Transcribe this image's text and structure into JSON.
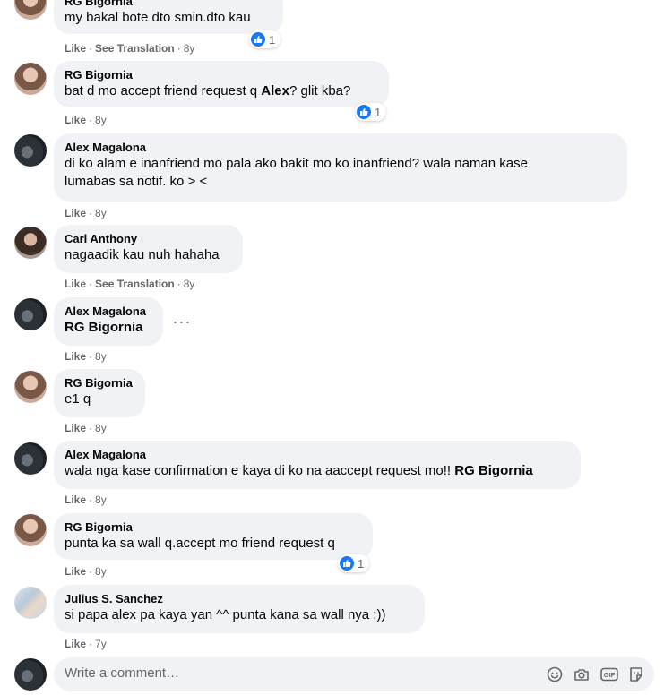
{
  "comments": [
    {
      "author": "RG Bigornia",
      "text": "my bakal bote dto smin.dto kau",
      "actions": [
        "Like",
        "See Translation"
      ],
      "time": "8y",
      "reactions": "1"
    },
    {
      "author": "RG Bigornia",
      "text_before": "bat d mo accept friend request q ",
      "mention": "Alex",
      "text_after": "? glit kba?",
      "actions": [
        "Like"
      ],
      "time": "8y",
      "reactions": "1"
    },
    {
      "author": "Alex Magalona",
      "text_line1": "di ko alam e inanfriend mo pala ako bakit mo ko inanfriend? wala naman kase",
      "text_line2": "lumabas sa notif. ko > <",
      "actions": [
        "Like"
      ],
      "time": "8y"
    },
    {
      "author": "Carl Anthony",
      "text": "nagaadik kau nuh hahaha",
      "actions": [
        "Like",
        "See Translation"
      ],
      "time": "8y"
    },
    {
      "author": "Alex Magalona",
      "mention": "RG Bigornia",
      "actions": [
        "Like"
      ],
      "time": "8y"
    },
    {
      "author": "RG Bigornia",
      "text": "e1 q",
      "actions": [
        "Like"
      ],
      "time": "8y"
    },
    {
      "author": "Alex Magalona",
      "text_before": "wala nga kase confirmation e kaya di ko na aaccept request mo!! ",
      "mention": "RG Bigornia",
      "actions": [
        "Like"
      ],
      "time": "8y"
    },
    {
      "author": "RG Bigornia",
      "text": "punta ka sa wall q.accept mo friend request q",
      "actions": [
        "Like"
      ],
      "time": "8y",
      "reactions": "1"
    },
    {
      "author": "Julius S. Sanchez",
      "text": "si papa alex pa kaya yan ^^ punta kana sa wall nya :))",
      "actions": [
        "Like"
      ],
      "time": "7y"
    }
  ],
  "composer": {
    "placeholder": "Write a comment…",
    "icons": [
      "emoji-icon",
      "camera-icon",
      "gif-icon",
      "sticker-icon"
    ],
    "gif_label": "GIF"
  },
  "colors": {
    "bubble": "#f0f2f5",
    "like_blue": "#1877f2",
    "meta_gray": "#65676b"
  }
}
